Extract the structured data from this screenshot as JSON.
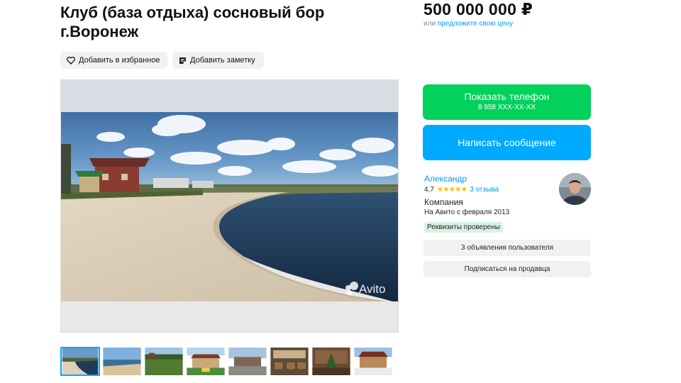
{
  "listing": {
    "title": "Клуб (база отдыха) сосновый бор г.Воронеж",
    "favorite_label": "Добавить в избранное",
    "note_label": "Добавить заметку",
    "watermark": "Avito"
  },
  "price": {
    "value": "500 000 000 ₽",
    "or_text": "или",
    "offer_link": "предложите свою цену"
  },
  "contact": {
    "phone_label": "Показать телефон",
    "phone_masked": "8 958 XXX-XX-XX",
    "message_label": "Написать сообщение"
  },
  "seller": {
    "name": "Александр",
    "rating": "4,7",
    "rating_stars": 4.7,
    "reviews": "3 отзыва",
    "type": "Компания",
    "since": "На Авито с февраля 2013",
    "verified_badge": "Реквизиты проверены",
    "ads_button": "3 объявления пользователя",
    "subscribe_button": "Подписаться на продавца"
  },
  "gallery": {
    "thumbnail_count": 8,
    "active_index": 0
  },
  "colors": {
    "green": "#02d15c",
    "blue": "#00aaff",
    "link": "#0099f7",
    "star": "#ffb800"
  }
}
